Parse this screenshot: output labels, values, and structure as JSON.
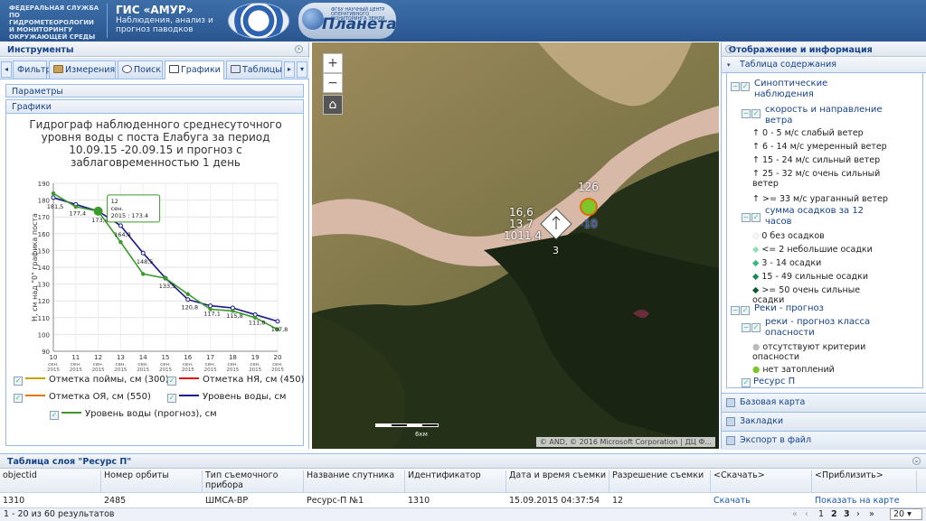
{
  "header": {
    "agency": "ФЕДЕРАЛЬНАЯ СЛУЖБА ПО ГИДРОМЕТЕОРОЛОГИИ И МОНИТОРИНГУ ОКРУЖАЮЩЕЙ СРЕДЫ",
    "title": "ГИС «АМУР»",
    "subtitle": "Наблюдения, анализ и прогноз паводков",
    "logo2_small": "ФГБУ НАУЧНЫЙ ЦЕНТР ОПЕРАТИВНОГО МОНИТОРИНГА ЗЕМЛИ",
    "logo2_big": "Планета"
  },
  "tools": {
    "title": "Инструменты",
    "tabs": [
      "Фильтр",
      "Измерения",
      "Поиск",
      "Графики",
      "Таблицы"
    ],
    "params_label": "Параметры",
    "graphs_label": "Графики"
  },
  "chart_title": "Гидрограф наблюденного среднесуточного уровня воды с поста Елабуга за период 10.09.15 -20.09.15 и прогноз с заблаговременностью 1 день",
  "chart_data": {
    "type": "line",
    "ylabel": "Н, см над \"0\" графика поста",
    "ylim": [
      90,
      190
    ],
    "yticks": [
      90,
      100,
      110,
      120,
      130,
      140,
      150,
      160,
      170,
      180,
      190
    ],
    "x": [
      10,
      11,
      12,
      13,
      14,
      15,
      16,
      17,
      18,
      19,
      20
    ],
    "xtick_sub": [
      "сен.",
      "2015"
    ],
    "series": [
      {
        "name": "Уровень воды, см",
        "color": "#1a1a8c",
        "values": [
          181.5,
          177.4,
          173.4,
          164.8,
          148.5,
          133.5,
          120.8,
          117.1,
          115.8,
          111.8,
          107.8
        ]
      },
      {
        "name": "Уровень воды (прогноз), см",
        "color": "#3a9a2a",
        "values": [
          184,
          176,
          173.4,
          155,
          136,
          133.5,
          124,
          115,
          114,
          110,
          103
        ]
      }
    ],
    "point_labels": [
      "181,5",
      "177,4",
      "173,4",
      "164,8",
      "148,5",
      "133,5",
      "120,8",
      "117,1",
      "115,8",
      "111,8",
      "107,8"
    ],
    "point_labels_secondary": [
      "",
      "",
      "",
      "",
      "",
      "",
      "",
      "",
      "",
      "",
      ""
    ],
    "extra_labels": [
      "120,8",
      "117,1",
      "111,8",
      "107,8"
    ],
    "tooltip": {
      "line1": "12",
      "line2": "сен.",
      "line3": "2015 : 173.4"
    }
  },
  "legend": [
    {
      "label": "Отметка поймы, см (300)",
      "color": "#c8a000"
    },
    {
      "label": "Отметка НЯ, см (450)",
      "color": "#d11"
    },
    {
      "label": "Отметка ОЯ, см (550)",
      "color": "#e07a00"
    },
    {
      "label": "Уровень воды, см",
      "color": "#1a1a8c"
    },
    {
      "label": "Уровень воды (прогноз), см",
      "color": "#3a9a2a"
    }
  ],
  "map": {
    "station_values": [
      "16,6",
      "13,7",
      "1011,4",
      "3"
    ],
    "point_values": [
      "126",
      "-10"
    ],
    "attribution": "© AND, © 2016 Microsoft Corporation | ДЦ Ф...",
    "scale_label": "6км"
  },
  "right": {
    "title": "Отображение и информация",
    "toc_title": "Таблица содержания",
    "items": {
      "synop": "Синоптические наблюдения",
      "wind": "скорость и направление ветра",
      "w1": "0 - 5 м/с слабый ветер",
      "w2": "6 - 14 м/с умеренный ветер",
      "w3": "15 - 24 м/с сильный ветер",
      "w4": "25 - 32 м/с очень сильный ветер",
      "w5": ">= 33 м/с ураганный ветер",
      "precip": "сумма осадков за 12 часов",
      "p1": "0 без осадков",
      "p2": "<= 2 небольшие осадки",
      "p3": "3 - 14 осадки",
      "p4": "15 - 49 сильные осадки",
      "p5": ">= 50 очень сильные осадки",
      "rivers": "Реки - прогноз",
      "rivers_class": "реки - прогноз класса опасности",
      "r1": "отсутствуют критерии опасности",
      "r2": "нет затоплений",
      "resurs": "Ресурс П"
    },
    "accordion": [
      "Базовая карта",
      "Закладки",
      "Экспорт в файл"
    ]
  },
  "table": {
    "title": "Таблица слоя \"Ресурс П\"",
    "columns": [
      "objectid",
      "Номер орбиты",
      "Тип съемочного прибора",
      "Название спутника",
      "Идентификатор",
      "Дата и время съемки",
      "Разрешение съемки",
      "<Скачать>",
      "<Приблизить>"
    ],
    "row": [
      "1310",
      "2485",
      "ШМСА-ВР",
      "Ресурс-П №1",
      "1310",
      "15.09.2015 04:37:54",
      "12",
      "Скачать",
      "Показать на карте"
    ],
    "paging_text": "1 - 20 из 60 результатов",
    "pages": [
      "1",
      "2",
      "3"
    ],
    "page_size": "20"
  }
}
